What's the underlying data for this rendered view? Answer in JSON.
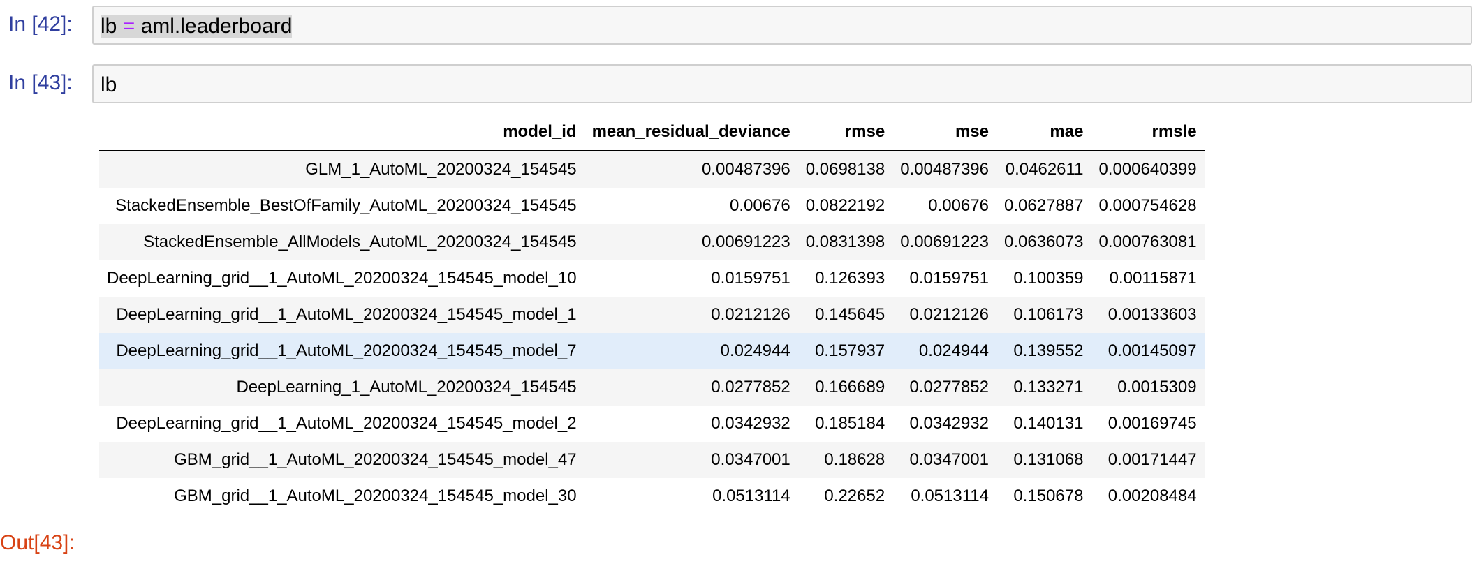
{
  "cells": [
    {
      "prompt": "In [42]:",
      "code_selected": "lb",
      "code_op": "=",
      "code_rest": "aml.leaderboard"
    },
    {
      "prompt": "In [43]:",
      "code": "lb"
    }
  ],
  "output_prompt": "Out[43]:",
  "table": {
    "columns": [
      "model_id",
      "mean_residual_deviance",
      "rmse",
      "mse",
      "mae",
      "rmsle"
    ],
    "rows": [
      [
        "GLM_1_AutoML_20200324_154545",
        "0.00487396",
        "0.0698138",
        "0.00487396",
        "0.0462611",
        "0.000640399"
      ],
      [
        "StackedEnsemble_BestOfFamily_AutoML_20200324_154545",
        "0.00676",
        "0.0822192",
        "0.00676",
        "0.0627887",
        "0.000754628"
      ],
      [
        "StackedEnsemble_AllModels_AutoML_20200324_154545",
        "0.00691223",
        "0.0831398",
        "0.00691223",
        "0.0636073",
        "0.000763081"
      ],
      [
        "DeepLearning_grid__1_AutoML_20200324_154545_model_10",
        "0.0159751",
        "0.126393",
        "0.0159751",
        "0.100359",
        "0.00115871"
      ],
      [
        "DeepLearning_grid__1_AutoML_20200324_154545_model_1",
        "0.0212126",
        "0.145645",
        "0.0212126",
        "0.106173",
        "0.00133603"
      ],
      [
        "DeepLearning_grid__1_AutoML_20200324_154545_model_7",
        "0.024944",
        "0.157937",
        "0.024944",
        "0.139552",
        "0.00145097"
      ],
      [
        "DeepLearning_1_AutoML_20200324_154545",
        "0.0277852",
        "0.166689",
        "0.0277852",
        "0.133271",
        "0.0015309"
      ],
      [
        "DeepLearning_grid__1_AutoML_20200324_154545_model_2",
        "0.0342932",
        "0.185184",
        "0.0342932",
        "0.140131",
        "0.00169745"
      ],
      [
        "GBM_grid__1_AutoML_20200324_154545_model_47",
        "0.0347001",
        "0.18628",
        "0.0347001",
        "0.131068",
        "0.00171447"
      ],
      [
        "GBM_grid__1_AutoML_20200324_154545_model_30",
        "0.0513114",
        "0.22652",
        "0.0513114",
        "0.150678",
        "0.00208484"
      ]
    ],
    "hovered_row": 5
  },
  "colors": {
    "in_prompt": "#303f9f",
    "out_prompt": "#d84315",
    "operator": "#aa22ff",
    "input_bg": "#f7f7f7",
    "stripe": "#f5f5f5",
    "hover_row": "#e1edfa"
  }
}
